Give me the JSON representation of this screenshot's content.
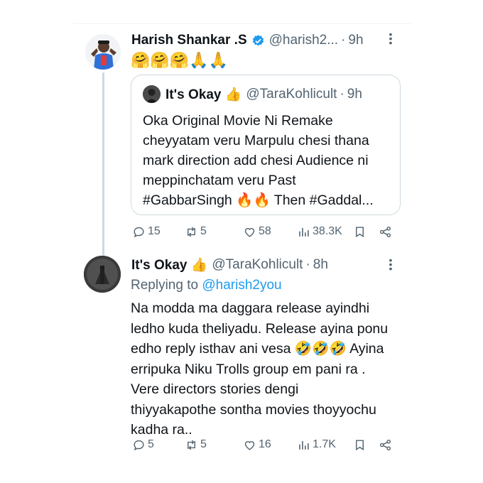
{
  "tweet1": {
    "name": "Harish Shankar .S",
    "handle": "@harish2...",
    "sep": "·",
    "time": "9h",
    "text": "🤗🤗🤗🙏🙏",
    "quote": {
      "name": "It's Okay 👍",
      "handle": "@TaraKohlicult",
      "sep": "·",
      "time": "9h",
      "lines": [
        "Oka Original Movie Ni Remake",
        "cheyyatam veru Marpulu chesi thana",
        "mark direction add chesi Audience ni",
        "meppinchatam veru Past",
        "#GabbarSingh 🔥🔥 Then #Gaddal..."
      ]
    },
    "actions": {
      "replies": "15",
      "reposts": "5",
      "likes": "58",
      "views": "38.3K"
    }
  },
  "tweet2": {
    "name": "It's Okay 👍",
    "handle": "@TaraKohlicult",
    "sep": "·",
    "time": "8h",
    "replying_prefix": "Replying to ",
    "replying_handle": "@harish2you",
    "lines": [
      "Na modda ma daggara release ayindhi",
      "ledho kuda theliyadu. Release ayina ponu",
      "edho reply isthav ani vesa 🤣🤣🤣 Ayina",
      "erripuka Niku Trolls group em pani ra .",
      "Vere directors stories dengi",
      "thiyyakapothe sontha movies thoyyochu",
      "kadha ra.."
    ],
    "actions": {
      "replies": "5",
      "reposts": "5",
      "likes": "16",
      "views": "1.7K"
    }
  },
  "colors": {
    "verified": "#1d9bf0",
    "secondary": "#536471",
    "link": "#1d9bf0",
    "border": "#cfd9de"
  },
  "icons": [
    "verified-badge-icon",
    "more-icon",
    "reply-icon",
    "repost-icon",
    "like-icon",
    "views-icon",
    "bookmark-icon",
    "share-icon"
  ]
}
